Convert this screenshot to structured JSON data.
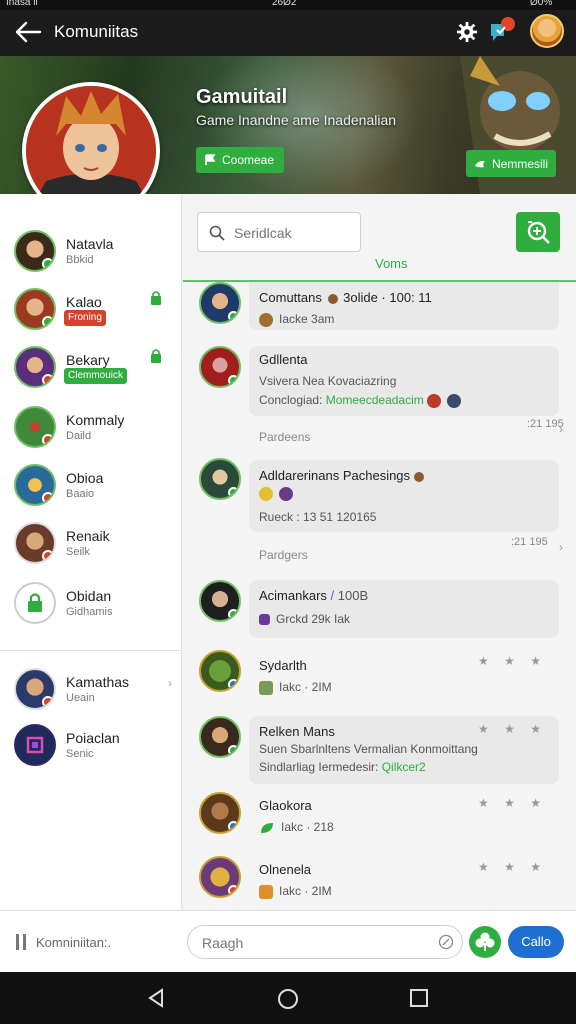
{
  "status_bar": {
    "left": "Inasa ii",
    "center": "26Ø2",
    "right": "Ø0%"
  },
  "app_bar": {
    "title": "Komuniitas"
  },
  "banner": {
    "title": "Gamuitail",
    "subtitle": "Game Inandne ame Inadenalian",
    "join_label": "Coomeae",
    "follow_label": "Nemmesili"
  },
  "sidebar": {
    "items": [
      {
        "name": "Natavla",
        "sub": "Bbkid",
        "color": "#7a4a2a"
      },
      {
        "name": "Kalao",
        "badge": "Froning",
        "badge_color": "#d0432c",
        "color": "#9b3a20",
        "locked": true
      },
      {
        "name": "Bekary",
        "badge": "Clemmouick",
        "badge_color": "#2fae3f",
        "color": "#5a2e7a",
        "locked": true
      },
      {
        "name": "Kommaly",
        "sub": "Daild",
        "color": "#3e8a3a"
      },
      {
        "name": "Obioa",
        "sub": "Baaio",
        "color": "#b0782a"
      },
      {
        "name": "Renaik",
        "sub": "Seilk",
        "color": "#6a3a2a"
      },
      {
        "name": "Obidan",
        "sub": "Gidhamis",
        "color": "#ffffff"
      },
      {
        "name": "Kamathas",
        "sub": "Ueain",
        "color": "#2a3a6a"
      },
      {
        "name": "Poiaclan",
        "sub": "Senic",
        "color": "#2a2a6a"
      }
    ]
  },
  "main": {
    "search_placeholder": "Seridlcak",
    "tab_label": "Voms",
    "messages": [
      {
        "title": "Comuttans",
        "title_suffix": "3olide · 100: 11",
        "line2": "Iacke 3am"
      },
      {
        "title": "Gdllenta",
        "line2": "Vsivera Nea Kovaciazring",
        "line3_prefix": "Conclogiad: ",
        "line3_hl": "Momeecdeadacim",
        "footer": "Pardeens",
        "time": ":21 195"
      },
      {
        "title": "Adldarerinans Pachesings",
        "line2": "Rueck : 13 51 120165",
        "footer": "Pardgers",
        "time": ":21 195"
      },
      {
        "title": "Acimankars",
        "title_suffix": "100B",
        "line2": "Grckd 29k Iak"
      },
      {
        "title": "Sydarlth",
        "line2": "Iakc · 2IM"
      },
      {
        "title": "Relken Mans",
        "line2": "Suen Sbarlnltens Vermalian Konmoittang",
        "line3_prefix": "Sindlarliag Iermedesir: ",
        "line3_hl": "Qilkcer2"
      },
      {
        "title": "Glaokora",
        "line2": "Iakc · 218"
      },
      {
        "title": "Olnenela",
        "line2": "Iakc · 2IM"
      }
    ],
    "stars": "★ ★ ★",
    "chevron": "›"
  },
  "input_bar": {
    "left_label": "Komniniitan:.",
    "placeholder": "Raagh",
    "send_label": "Callo"
  },
  "colors": {
    "accent": "#2fae3f",
    "send": "#1f6fd1",
    "appbar": "#1b1b1b"
  }
}
